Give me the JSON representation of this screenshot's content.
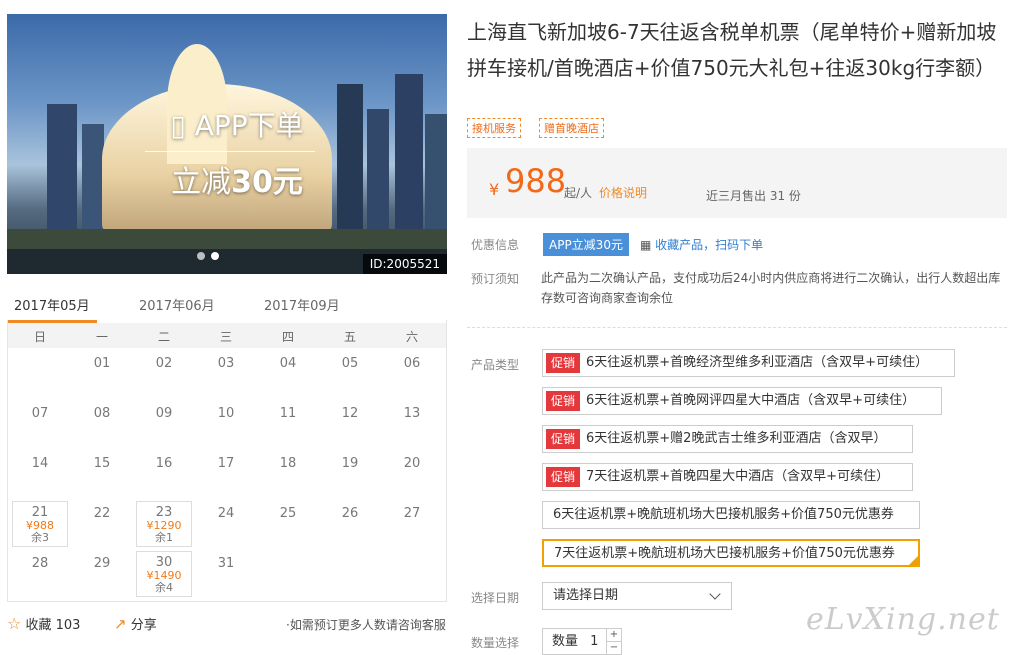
{
  "hero": {
    "promo_line1": "APP下单",
    "promo_line2_prefix": "立减",
    "promo_line2_amount": "30元",
    "image_id": "ID:2005521"
  },
  "calendar": {
    "months": [
      "2017年05月",
      "2017年06月",
      "2017年09月"
    ],
    "active_month": "2017年05月",
    "weekdays": [
      "日",
      "一",
      "二",
      "三",
      "四",
      "五",
      "六"
    ],
    "rows": [
      [
        "",
        "01",
        "02",
        "03",
        "04",
        "05",
        "06"
      ],
      [
        "07",
        "08",
        "09",
        "10",
        "11",
        "12",
        "13"
      ],
      [
        "14",
        "15",
        "16",
        "17",
        "18",
        "19",
        "20"
      ],
      [
        "21",
        "22",
        "23",
        "24",
        "25",
        "26",
        "27"
      ],
      [
        "28",
        "29",
        "30",
        "31",
        "",
        "",
        ""
      ]
    ],
    "available": [
      {
        "day": "21",
        "price": "¥988",
        "remain": "余3"
      },
      {
        "day": "23",
        "price": "¥1290",
        "remain": "余1"
      },
      {
        "day": "30",
        "price": "¥1490",
        "remain": "余4"
      }
    ]
  },
  "actions": {
    "favorite_label": "收藏",
    "favorite_count": "103",
    "share_label": "分享",
    "consult_text": "如需预订更多人数请咨询客服"
  },
  "product": {
    "title": "上海直飞新加坡6-7天往返含税单机票（尾单特价+赠新加坡拼车接机/首晚酒店+价值750元大礼包+往返30kg行李额）",
    "tags": [
      "接机服务",
      "赠首晚酒店"
    ],
    "price_symbol": "¥",
    "price": "988",
    "price_unit": "起/人",
    "price_desc": "价格说明",
    "sold": "近三月售出 31 份"
  },
  "info": {
    "discount_label": "优惠信息",
    "discount_badge": "APP立减30元",
    "qr_link": "收藏产品，扫码下单",
    "notice_label": "预订须知",
    "notice_text": "此产品为二次确认产品，支付成功后24小时内供应商将进行二次确认，出行人数超出库存数可咨询商家查询余位"
  },
  "options": {
    "label": "产品类型",
    "promo_badge": "促销",
    "items": [
      {
        "text": "6天往返机票+首晚经济型维多利亚酒店（含双早+可续住）",
        "promo": true
      },
      {
        "text": "6天往返机票+首晚网评四星大中酒店（含双早+可续住）",
        "promo": true
      },
      {
        "text": "6天往返机票+赠2晚武吉士维多利亚酒店（含双早）",
        "promo": true
      },
      {
        "text": "7天往返机票+首晚四星大中酒店（含双早+可续住）",
        "promo": true
      },
      {
        "text": "6天往返机票+晚航班机场大巴接机服务+价值750元优惠券",
        "promo": false
      },
      {
        "text": "7天往返机票+晚航班机场大巴接机服务+价值750元优惠券",
        "promo": false,
        "selected": true
      }
    ]
  },
  "date": {
    "label": "选择日期",
    "placeholder": "请选择日期"
  },
  "quantity": {
    "label": "数量选择",
    "prefix": "数量",
    "value": "1",
    "plus": "+",
    "minus": "−"
  },
  "watermark": "eLvXing.net",
  "colors": {
    "accent": "#f06a1a",
    "promo_red": "#e4393c",
    "link_blue": "#2f7fd1",
    "selected_border": "#f0a000"
  }
}
